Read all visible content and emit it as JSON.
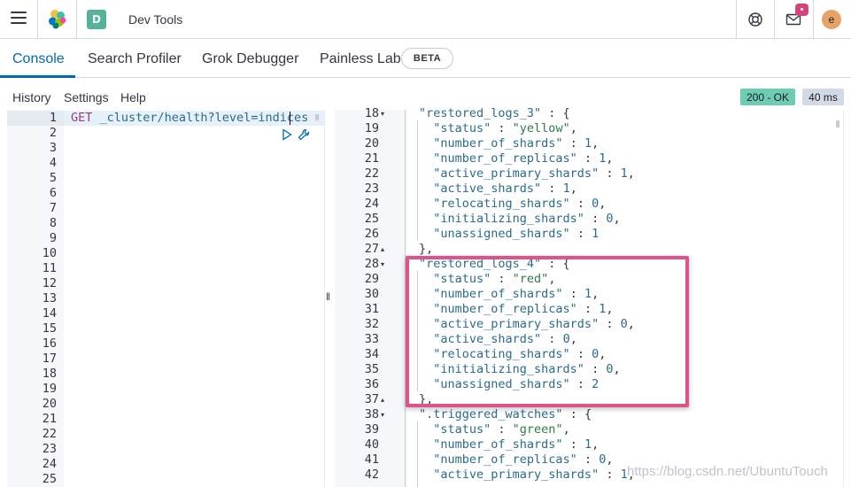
{
  "header": {
    "space_initial": "D",
    "app_title": "Dev Tools",
    "avatar_initial": "e"
  },
  "tabs": [
    {
      "label": "Console",
      "active": true
    },
    {
      "label": "Search Profiler",
      "active": false
    },
    {
      "label": "Grok Debugger",
      "active": false
    },
    {
      "label": "Painless Lab",
      "active": false
    }
  ],
  "beta_badge": "BETA",
  "toolbar": {
    "history": "History",
    "settings": "Settings",
    "help": "Help",
    "status_code": "200 - OK",
    "response_time": "40 ms"
  },
  "request": {
    "line_numbers": [
      "1",
      "2",
      "3",
      "4",
      "5",
      "6",
      "7",
      "8",
      "9",
      "10",
      "11",
      "12",
      "13",
      "14",
      "15",
      "16",
      "17",
      "18",
      "19",
      "20",
      "21",
      "22",
      "23",
      "24",
      "25"
    ],
    "method": "GET",
    "url": "_cluster/health?level=indices"
  },
  "response": {
    "lines": [
      {
        "n": "18",
        "fold": "▾",
        "key": "\"restored_logs_3\"",
        "rest": " : {"
      },
      {
        "n": "19",
        "fold": "",
        "key": "  \"status\"",
        "rest": " : ",
        "val": "\"yellow\"",
        "tail": ","
      },
      {
        "n": "20",
        "fold": "",
        "key": "  \"number_of_shards\"",
        "rest": " : ",
        "num": "1",
        "tail": ","
      },
      {
        "n": "21",
        "fold": "",
        "key": "  \"number_of_replicas\"",
        "rest": " : ",
        "num": "1",
        "tail": ","
      },
      {
        "n": "22",
        "fold": "",
        "key": "  \"active_primary_shards\"",
        "rest": " : ",
        "num": "1",
        "tail": ","
      },
      {
        "n": "23",
        "fold": "",
        "key": "  \"active_shards\"",
        "rest": " : ",
        "num": "1",
        "tail": ","
      },
      {
        "n": "24",
        "fold": "",
        "key": "  \"relocating_shards\"",
        "rest": " : ",
        "num": "0",
        "tail": ","
      },
      {
        "n": "25",
        "fold": "",
        "key": "  \"initializing_shards\"",
        "rest": " : ",
        "num": "0",
        "tail": ","
      },
      {
        "n": "26",
        "fold": "",
        "key": "  \"unassigned_shards\"",
        "rest": " : ",
        "num": "1",
        "tail": ""
      },
      {
        "n": "27",
        "fold": "▴",
        "key": "",
        "rest": "},"
      },
      {
        "n": "28",
        "fold": "▾",
        "key": "\"restored_logs_4\"",
        "rest": " : {"
      },
      {
        "n": "29",
        "fold": "",
        "key": "  \"status\"",
        "rest": " : ",
        "val": "\"red\"",
        "tail": ","
      },
      {
        "n": "30",
        "fold": "",
        "key": "  \"number_of_shards\"",
        "rest": " : ",
        "num": "1",
        "tail": ","
      },
      {
        "n": "31",
        "fold": "",
        "key": "  \"number_of_replicas\"",
        "rest": " : ",
        "num": "1",
        "tail": ","
      },
      {
        "n": "32",
        "fold": "",
        "key": "  \"active_primary_shards\"",
        "rest": " : ",
        "num": "0",
        "tail": ","
      },
      {
        "n": "33",
        "fold": "",
        "key": "  \"active_shards\"",
        "rest": " : ",
        "num": "0",
        "tail": ","
      },
      {
        "n": "34",
        "fold": "",
        "key": "  \"relocating_shards\"",
        "rest": " : ",
        "num": "0",
        "tail": ","
      },
      {
        "n": "35",
        "fold": "",
        "key": "  \"initializing_shards\"",
        "rest": " : ",
        "num": "0",
        "tail": ","
      },
      {
        "n": "36",
        "fold": "",
        "key": "  \"unassigned_shards\"",
        "rest": " : ",
        "num": "2",
        "tail": ""
      },
      {
        "n": "37",
        "fold": "▴",
        "key": "",
        "rest": "},"
      },
      {
        "n": "38",
        "fold": "▾",
        "key": "\".triggered_watches\"",
        "rest": " : {"
      },
      {
        "n": "39",
        "fold": "",
        "key": "  \"status\"",
        "rest": " : ",
        "val": "\"green\"",
        "tail": ","
      },
      {
        "n": "40",
        "fold": "",
        "key": "  \"number_of_shards\"",
        "rest": " : ",
        "num": "1",
        "tail": ","
      },
      {
        "n": "41",
        "fold": "",
        "key": "  \"number_of_replicas\"",
        "rest": " : ",
        "num": "0",
        "tail": ","
      },
      {
        "n": "42",
        "fold": "",
        "key": "  \"active_primary_shards\"",
        "rest": " : ",
        "num": "1",
        "tail": ","
      }
    ]
  },
  "watermark": "https://blog.csdn.net/UbuntuTouch",
  "colors": {
    "accent": "#006bb4",
    "status_ok": "#6dccb1",
    "highlight": "#e0528a",
    "space_badge": "#54b399",
    "notification": "#d6437a",
    "avatar": "#e7a367"
  }
}
